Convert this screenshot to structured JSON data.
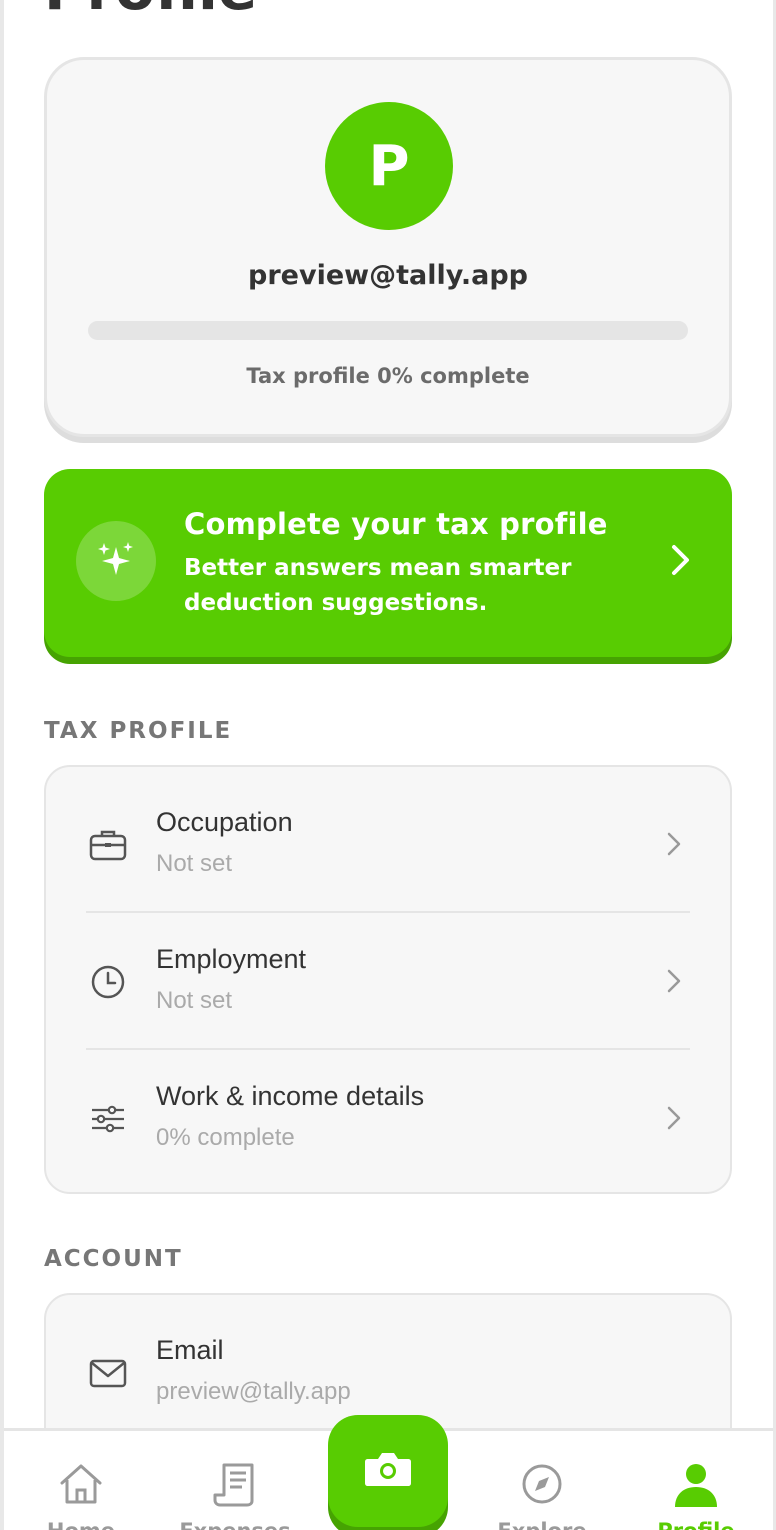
{
  "page": {
    "title": "Profile"
  },
  "profile": {
    "avatar_letter": "P",
    "email": "preview@tally.app",
    "progress_fraction": 0,
    "progress_text": "Tax profile 0% complete"
  },
  "banner": {
    "title": "Complete your tax profile",
    "subtitle": "Better answers mean smarter deduction suggestions.",
    "icon": "sparkles-icon"
  },
  "tax_profile": {
    "header": "TAX PROFILE",
    "items": [
      {
        "label": "Occupation",
        "value": "Not set",
        "icon": "briefcase-icon"
      },
      {
        "label": "Employment",
        "value": "Not set",
        "icon": "clock-icon"
      },
      {
        "label": "Work & income details",
        "value": "0% complete",
        "icon": "sliders-icon"
      }
    ]
  },
  "account": {
    "header": "ACCOUNT",
    "items": [
      {
        "label": "Email",
        "value": "preview@tally.app",
        "icon": "mail-icon"
      }
    ]
  },
  "nav": {
    "items": [
      {
        "label": "Home",
        "icon": "home-icon"
      },
      {
        "label": "Expenses",
        "icon": "receipt-icon"
      },
      {
        "label": "",
        "icon": "camera-icon"
      },
      {
        "label": "Explore",
        "icon": "compass-icon"
      },
      {
        "label": "Profile",
        "icon": "user-icon",
        "active": true
      }
    ]
  },
  "colors": {
    "accent": "#58cc02",
    "accent_dark": "#46a302",
    "muted": "#aaaaaa"
  }
}
